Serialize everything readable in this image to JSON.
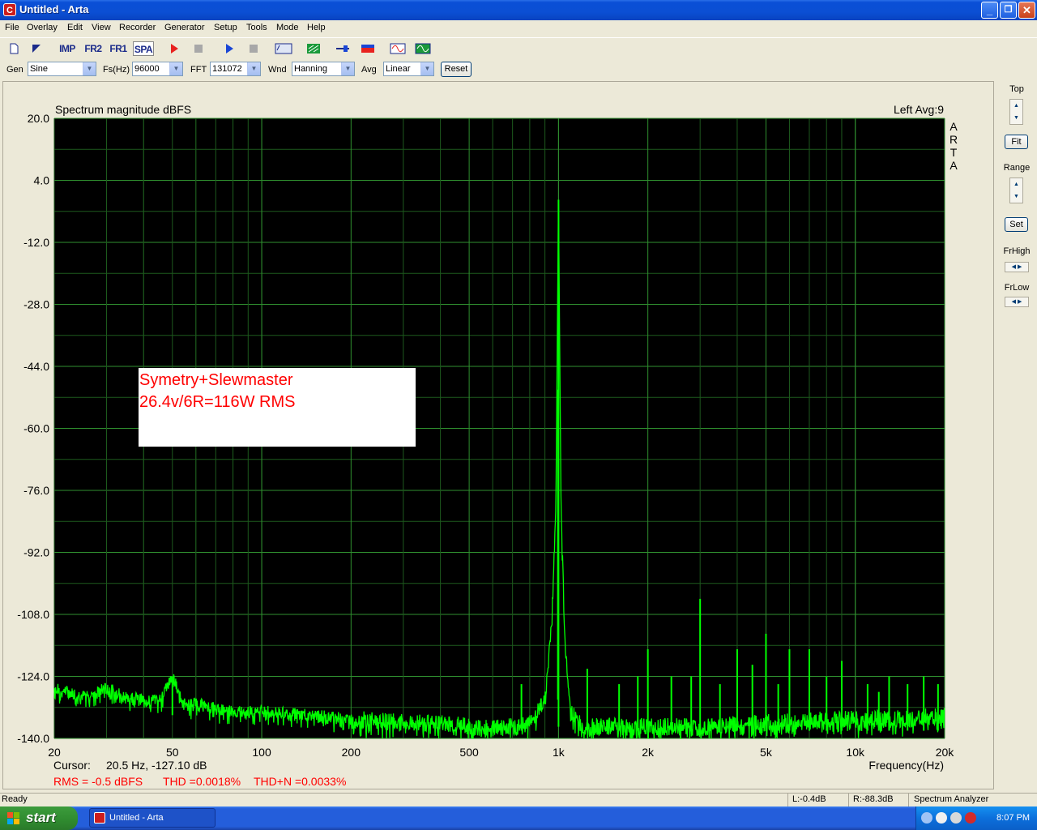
{
  "window": {
    "title": "Untitled - Arta",
    "minimize": "_",
    "maximize": "❐",
    "close": "✕"
  },
  "menu": [
    "File",
    "Overlay",
    "Edit",
    "View",
    "Recorder",
    "Generator",
    "Setup",
    "Tools",
    "Mode",
    "Help"
  ],
  "toolbar": {
    "imp": "IMP",
    "fr2": "FR2",
    "fr1": "FR1",
    "spa": "SPA",
    "colors": {
      "record": "#e8221f",
      "play": "#1a46d6",
      "stop": "#8a8a8a",
      "green": "#1a9a3a"
    }
  },
  "controls": {
    "gen_label": "Gen",
    "gen_value": "Sine",
    "fs_label": "Fs(Hz)",
    "fs_value": "96000",
    "fft_label": "FFT",
    "fft_value": "131072",
    "wnd_label": "Wnd",
    "wnd_value": "Hanning",
    "avg_label": "Avg",
    "avg_value": "Linear",
    "reset": "Reset"
  },
  "plot": {
    "title": "Spectrum magnitude dBFS",
    "channel_info": "Left  Avg:9",
    "watermark": [
      "A",
      "R",
      "T",
      "A"
    ],
    "annotation": [
      "Symetry+Slewmaster",
      "26.4v/6R=116W RMS"
    ],
    "cursor_label": "Cursor:",
    "cursor_value": "20.5 Hz, -127.10 dB",
    "xlabel": "Frequency(Hz)",
    "measurements": {
      "rms": "RMS =   -0.5 dBFS",
      "thd": "THD =0.0018%",
      "thdn": "THD+N =0.0033%"
    },
    "colors": {
      "background": "#000000",
      "grid": "#2f8f2f",
      "trace": "#00ff00",
      "annotation_text": "#ff0000",
      "measurement_text": "#ff0000"
    }
  },
  "chart_data": {
    "type": "line",
    "title": "Spectrum magnitude dBFS",
    "xlabel": "Frequency(Hz)",
    "ylabel": "",
    "xscale": "log",
    "xlim": [
      20,
      20000
    ],
    "ylim": [
      -140,
      20
    ],
    "grid": true,
    "x_ticks": [
      "20",
      "50",
      "100",
      "200",
      "500",
      "1k",
      "2k",
      "5k",
      "10k",
      "20k"
    ],
    "x_tick_values": [
      20,
      50,
      100,
      200,
      500,
      1000,
      2000,
      5000,
      10000,
      20000
    ],
    "y_ticks": [
      "20.0",
      "4.0",
      "-12.0",
      "-28.0",
      "-44.0",
      "-60.0",
      "-76.0",
      "-92.0",
      "-108.0",
      "-124.0",
      "-140.0"
    ],
    "y_tick_values": [
      20,
      4,
      -12,
      -28,
      -44,
      -60,
      -76,
      -92,
      -108,
      -124,
      -140
    ],
    "series": [
      {
        "x": [
          20,
          25,
          30,
          35,
          40,
          45,
          50,
          55,
          60,
          70,
          80,
          100,
          150,
          200,
          300,
          400,
          500,
          600,
          700,
          800,
          900,
          950,
          980,
          1000,
          1020,
          1050,
          1100,
          1200,
          1500,
          2000,
          3000,
          5000,
          10000,
          15000,
          20000
        ],
        "y": [
          -127,
          -129,
          -127,
          -129,
          -130,
          -130,
          -124,
          -131,
          -131,
          -132,
          -133,
          -133,
          -134,
          -135,
          -136,
          -136,
          -137,
          -137,
          -137,
          -136,
          -130,
          -110,
          -80,
          -1,
          -80,
          -115,
          -133,
          -137,
          -137,
          -137,
          -137,
          -136,
          -135,
          -135,
          -134
        ]
      }
    ],
    "harmonics": [
      {
        "x": 750,
        "y": -126
      },
      {
        "x": 1250,
        "y": -122
      },
      {
        "x": 1600,
        "y": -126
      },
      {
        "x": 1850,
        "y": -124
      },
      {
        "x": 2000,
        "y": -117
      },
      {
        "x": 2400,
        "y": -124
      },
      {
        "x": 2800,
        "y": -124
      },
      {
        "x": 3000,
        "y": -104
      },
      {
        "x": 3500,
        "y": -126
      },
      {
        "x": 4000,
        "y": -117
      },
      {
        "x": 4500,
        "y": -121
      },
      {
        "x": 5000,
        "y": -113
      },
      {
        "x": 5500,
        "y": -126
      },
      {
        "x": 6000,
        "y": -117
      },
      {
        "x": 7000,
        "y": -117
      },
      {
        "x": 8000,
        "y": -124
      },
      {
        "x": 9000,
        "y": -120
      },
      {
        "x": 11000,
        "y": -126
      },
      {
        "x": 12000,
        "y": -128
      },
      {
        "x": 13000,
        "y": -124
      },
      {
        "x": 15000,
        "y": -126
      },
      {
        "x": 17000,
        "y": -124
      },
      {
        "x": 19000,
        "y": -126
      }
    ],
    "mains_spur": {
      "x": 50,
      "y": -124
    }
  },
  "right_panel": {
    "top": "Top",
    "fit": "Fit",
    "range": "Range",
    "set": "Set",
    "frhigh": "FrHigh",
    "frlow": "FrLow"
  },
  "status": {
    "left": "Ready",
    "l_level": "L:-0.4dB",
    "r_level": "R:-88.3dB",
    "mode": "Spectrum Analyzer"
  },
  "taskbar": {
    "start": "start",
    "task": "Untitled - Arta",
    "clock": "8:07 PM"
  }
}
